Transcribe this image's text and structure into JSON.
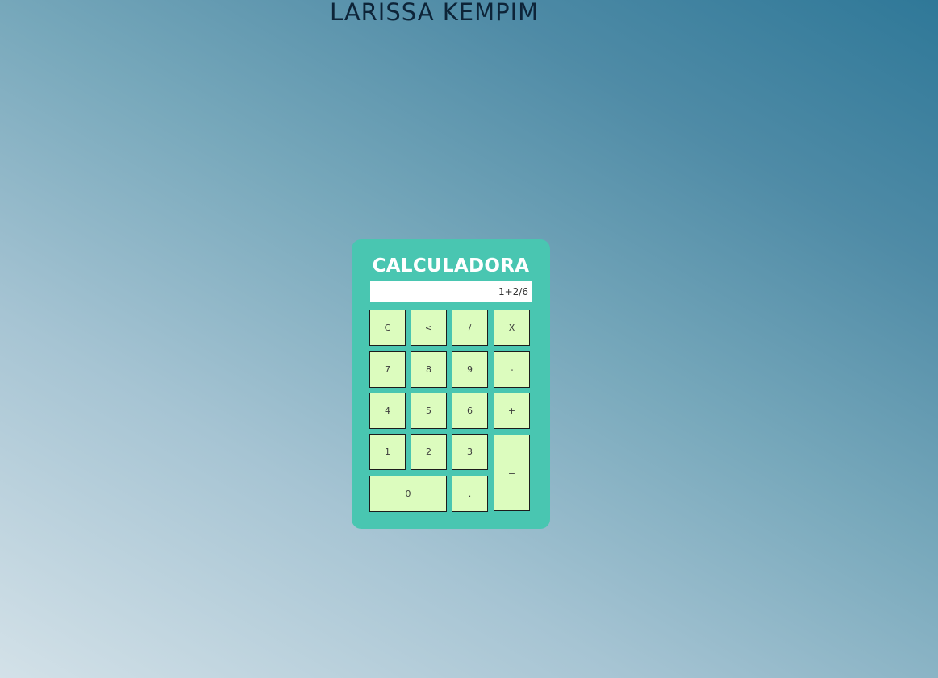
{
  "page": {
    "title": "LARISSA KEMPIM"
  },
  "calculator": {
    "title": "CALCULADORA",
    "display_value": "1+2/6",
    "keys": {
      "clear": "C",
      "backspace": "<",
      "divide": "/",
      "multiply": "X",
      "seven": "7",
      "eight": "8",
      "nine": "9",
      "minus": "-",
      "four": "4",
      "five": "5",
      "six": "6",
      "plus": "+",
      "one": "1",
      "two": "2",
      "three": "3",
      "equals": "=",
      "zero": "0",
      "decimal": "."
    }
  },
  "colors": {
    "panel": "#49c6b1",
    "key_background": "#dcfcbe",
    "title_text": "#0d2438",
    "display_background": "#ffffff"
  }
}
